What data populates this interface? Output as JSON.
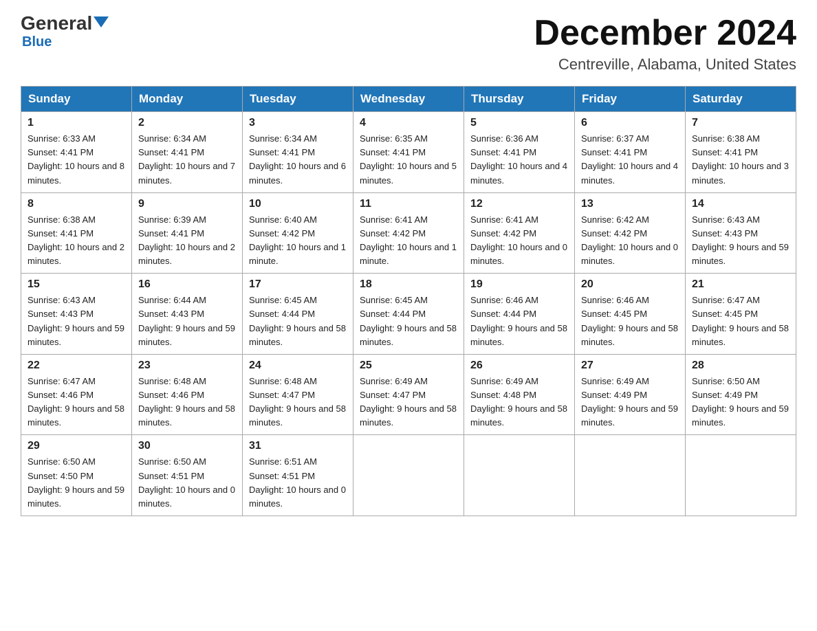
{
  "header": {
    "logo_main": "General",
    "logo_sub": "Blue",
    "month_year": "December 2024",
    "location": "Centreville, Alabama, United States"
  },
  "days_of_week": [
    "Sunday",
    "Monday",
    "Tuesday",
    "Wednesday",
    "Thursday",
    "Friday",
    "Saturday"
  ],
  "weeks": [
    [
      {
        "num": "1",
        "sunrise": "6:33 AM",
        "sunset": "4:41 PM",
        "daylight": "10 hours and 8 minutes."
      },
      {
        "num": "2",
        "sunrise": "6:34 AM",
        "sunset": "4:41 PM",
        "daylight": "10 hours and 7 minutes."
      },
      {
        "num": "3",
        "sunrise": "6:34 AM",
        "sunset": "4:41 PM",
        "daylight": "10 hours and 6 minutes."
      },
      {
        "num": "4",
        "sunrise": "6:35 AM",
        "sunset": "4:41 PM",
        "daylight": "10 hours and 5 minutes."
      },
      {
        "num": "5",
        "sunrise": "6:36 AM",
        "sunset": "4:41 PM",
        "daylight": "10 hours and 4 minutes."
      },
      {
        "num": "6",
        "sunrise": "6:37 AM",
        "sunset": "4:41 PM",
        "daylight": "10 hours and 4 minutes."
      },
      {
        "num": "7",
        "sunrise": "6:38 AM",
        "sunset": "4:41 PM",
        "daylight": "10 hours and 3 minutes."
      }
    ],
    [
      {
        "num": "8",
        "sunrise": "6:38 AM",
        "sunset": "4:41 PM",
        "daylight": "10 hours and 2 minutes."
      },
      {
        "num": "9",
        "sunrise": "6:39 AM",
        "sunset": "4:41 PM",
        "daylight": "10 hours and 2 minutes."
      },
      {
        "num": "10",
        "sunrise": "6:40 AM",
        "sunset": "4:42 PM",
        "daylight": "10 hours and 1 minute."
      },
      {
        "num": "11",
        "sunrise": "6:41 AM",
        "sunset": "4:42 PM",
        "daylight": "10 hours and 1 minute."
      },
      {
        "num": "12",
        "sunrise": "6:41 AM",
        "sunset": "4:42 PM",
        "daylight": "10 hours and 0 minutes."
      },
      {
        "num": "13",
        "sunrise": "6:42 AM",
        "sunset": "4:42 PM",
        "daylight": "10 hours and 0 minutes."
      },
      {
        "num": "14",
        "sunrise": "6:43 AM",
        "sunset": "4:43 PM",
        "daylight": "9 hours and 59 minutes."
      }
    ],
    [
      {
        "num": "15",
        "sunrise": "6:43 AM",
        "sunset": "4:43 PM",
        "daylight": "9 hours and 59 minutes."
      },
      {
        "num": "16",
        "sunrise": "6:44 AM",
        "sunset": "4:43 PM",
        "daylight": "9 hours and 59 minutes."
      },
      {
        "num": "17",
        "sunrise": "6:45 AM",
        "sunset": "4:44 PM",
        "daylight": "9 hours and 58 minutes."
      },
      {
        "num": "18",
        "sunrise": "6:45 AM",
        "sunset": "4:44 PM",
        "daylight": "9 hours and 58 minutes."
      },
      {
        "num": "19",
        "sunrise": "6:46 AM",
        "sunset": "4:44 PM",
        "daylight": "9 hours and 58 minutes."
      },
      {
        "num": "20",
        "sunrise": "6:46 AM",
        "sunset": "4:45 PM",
        "daylight": "9 hours and 58 minutes."
      },
      {
        "num": "21",
        "sunrise": "6:47 AM",
        "sunset": "4:45 PM",
        "daylight": "9 hours and 58 minutes."
      }
    ],
    [
      {
        "num": "22",
        "sunrise": "6:47 AM",
        "sunset": "4:46 PM",
        "daylight": "9 hours and 58 minutes."
      },
      {
        "num": "23",
        "sunrise": "6:48 AM",
        "sunset": "4:46 PM",
        "daylight": "9 hours and 58 minutes."
      },
      {
        "num": "24",
        "sunrise": "6:48 AM",
        "sunset": "4:47 PM",
        "daylight": "9 hours and 58 minutes."
      },
      {
        "num": "25",
        "sunrise": "6:49 AM",
        "sunset": "4:47 PM",
        "daylight": "9 hours and 58 minutes."
      },
      {
        "num": "26",
        "sunrise": "6:49 AM",
        "sunset": "4:48 PM",
        "daylight": "9 hours and 58 minutes."
      },
      {
        "num": "27",
        "sunrise": "6:49 AM",
        "sunset": "4:49 PM",
        "daylight": "9 hours and 59 minutes."
      },
      {
        "num": "28",
        "sunrise": "6:50 AM",
        "sunset": "4:49 PM",
        "daylight": "9 hours and 59 minutes."
      }
    ],
    [
      {
        "num": "29",
        "sunrise": "6:50 AM",
        "sunset": "4:50 PM",
        "daylight": "9 hours and 59 minutes."
      },
      {
        "num": "30",
        "sunrise": "6:50 AM",
        "sunset": "4:51 PM",
        "daylight": "10 hours and 0 minutes."
      },
      {
        "num": "31",
        "sunrise": "6:51 AM",
        "sunset": "4:51 PM",
        "daylight": "10 hours and 0 minutes."
      },
      null,
      null,
      null,
      null
    ]
  ],
  "labels": {
    "sunrise": "Sunrise:",
    "sunset": "Sunset:",
    "daylight": "Daylight:"
  }
}
